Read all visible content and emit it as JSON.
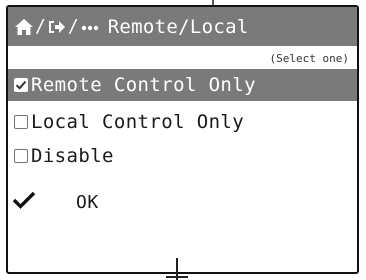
{
  "header": {
    "separator": "/",
    "icons": [
      "home-icon",
      "exit-arrow-icon",
      "more-dots-icon"
    ],
    "title": "Remote/Local"
  },
  "hint": "(Select one)",
  "options": [
    {
      "label": "Remote Control Only",
      "checked": true,
      "highlighted": true
    },
    {
      "label": "Local Control Only",
      "checked": false,
      "highlighted": false
    },
    {
      "label": "Disable",
      "checked": false,
      "highlighted": false
    }
  ],
  "ok": {
    "label": "OK",
    "icon": "checkmark-icon"
  },
  "colors": {
    "header_bg": "#7a7a7a",
    "selected_bg": "#7a7a7a",
    "text": "#1a1a1a"
  }
}
